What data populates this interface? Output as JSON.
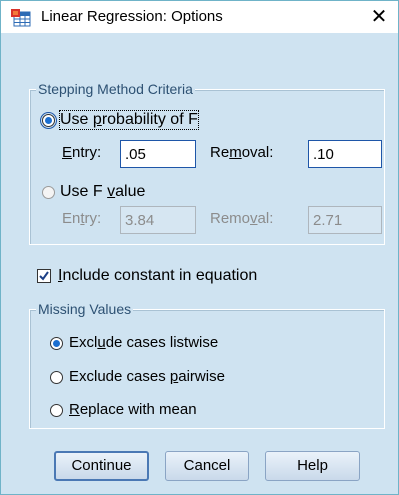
{
  "window": {
    "title": "Linear Regression: Options",
    "close_label": "✕"
  },
  "stepping": {
    "legend": "Stepping Method Criteria",
    "use_probability": {
      "label_prefix": "Use ",
      "label_key": "p",
      "label_suffix": "robability of F",
      "selected": true
    },
    "prob_entry": {
      "label_key": "E",
      "label_rest": "ntry:",
      "value": ".05"
    },
    "prob_removal": {
      "label_pre": "Re",
      "label_key": "m",
      "label_post": "oval:",
      "value": ".10"
    },
    "use_f_value": {
      "label_prefix": "Use F ",
      "label_key": "v",
      "label_suffix": "alue",
      "selected": false
    },
    "f_entry": {
      "label_pre": "En",
      "label_key": "t",
      "label_post": "ry:",
      "value": "3.84"
    },
    "f_removal": {
      "label_pre": "Remo",
      "label_key": "v",
      "label_post": "al:",
      "value": "2.71"
    }
  },
  "include_constant": {
    "label_key": "I",
    "label_rest": "nclude constant in equation",
    "checked": true
  },
  "missing": {
    "legend": "Missing Values",
    "options": [
      {
        "label_pre": "Excl",
        "label_key": "u",
        "label_post": "de cases listwise",
        "selected": true
      },
      {
        "label_pre": "Exclude cases ",
        "label_key": "p",
        "label_post": "airwise",
        "selected": false
      },
      {
        "label_pre": "",
        "label_key": "R",
        "label_post": "eplace with mean",
        "selected": false
      }
    ]
  },
  "buttons": {
    "continue": "Continue",
    "cancel": "Cancel",
    "help": "Help"
  },
  "colors": {
    "accent": "#1e56a8",
    "dialog_bg": "#cfe3f1",
    "legend_text": "#2d5173"
  }
}
